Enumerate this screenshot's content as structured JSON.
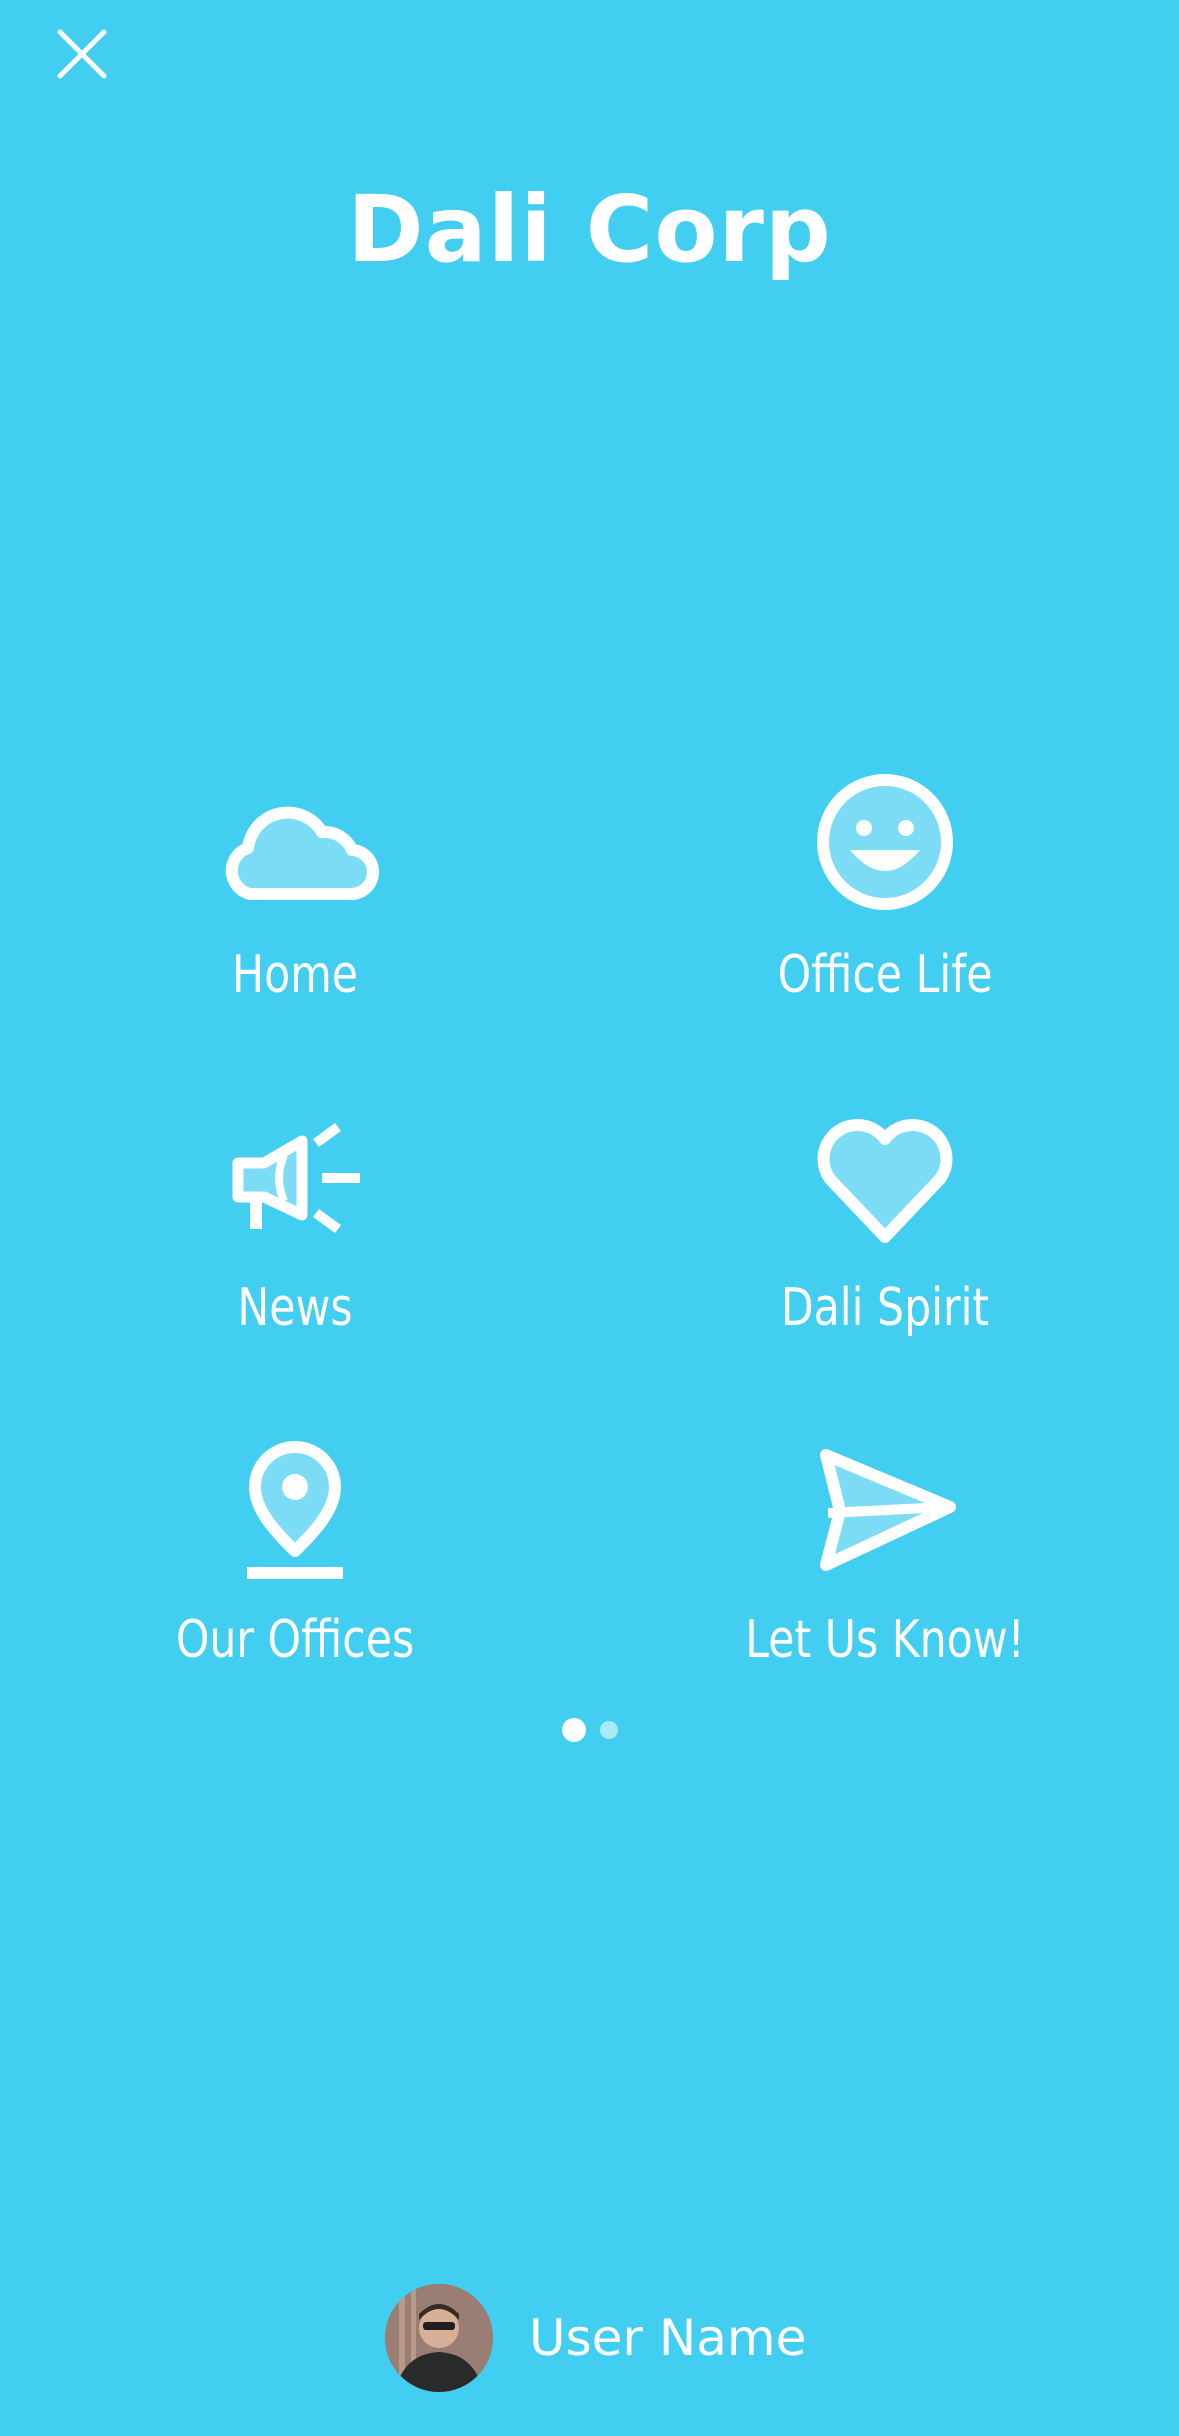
{
  "header": {
    "title": "Dali Corp",
    "close_icon": "close-icon"
  },
  "menu": {
    "items": [
      {
        "label": "Home",
        "icon": "cloud-icon"
      },
      {
        "label": "Office Life",
        "icon": "smiley-icon"
      },
      {
        "label": "News",
        "icon": "megaphone-icon"
      },
      {
        "label": "Dali Spirit",
        "icon": "heart-icon"
      },
      {
        "label": "Our Offices",
        "icon": "map-pin-icon"
      },
      {
        "label": "Let Us Know!",
        "icon": "send-icon"
      }
    ]
  },
  "pager": {
    "page_count": 2,
    "current_page": 1
  },
  "user": {
    "name": "User Name",
    "avatar_icon": "avatar"
  },
  "colors": {
    "background": "#41cef0",
    "foreground": "#ffffff",
    "icon_fill": "#7ddcf5"
  }
}
